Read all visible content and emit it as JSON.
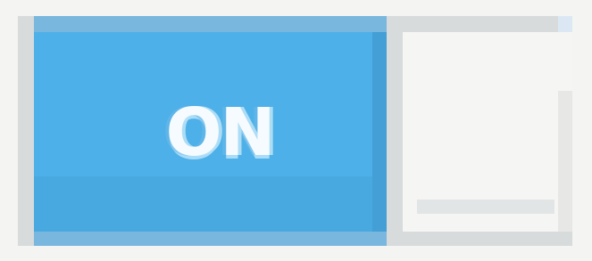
{
  "toggle": {
    "label": "ON",
    "state": "on",
    "active_color": "#4db0e8",
    "inactive_color": "#f5f5f4"
  }
}
